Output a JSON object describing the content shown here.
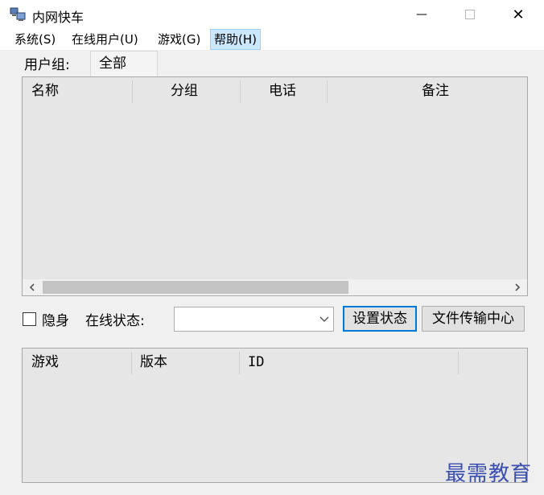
{
  "window": {
    "title": "内网快车",
    "minimize_glyph": "—",
    "close_glyph": "✕"
  },
  "menu": [
    {
      "label": "系统(S)"
    },
    {
      "label": "在线用户(U)"
    },
    {
      "label": "游戏(G)"
    },
    {
      "label": "帮助(H)"
    }
  ],
  "user_group": {
    "label": "用户组:",
    "tab": "全部"
  },
  "user_list": {
    "columns": [
      "名称",
      "分组",
      "电话",
      "备注"
    ],
    "rows": []
  },
  "hidden_checkbox": {
    "label": "隐身",
    "checked": false
  },
  "online_status": {
    "label": "在线状态:",
    "value": ""
  },
  "buttons": {
    "set_status": "设置状态",
    "file_transfer": "文件传输中心"
  },
  "game_list": {
    "columns": [
      "游戏",
      "版本",
      "ID"
    ],
    "rows": []
  },
  "watermark": "最需教育",
  "colors": {
    "accent": "#0078d7",
    "menu_highlight": "#cce8ff",
    "watermark": "#3a4fb0"
  }
}
